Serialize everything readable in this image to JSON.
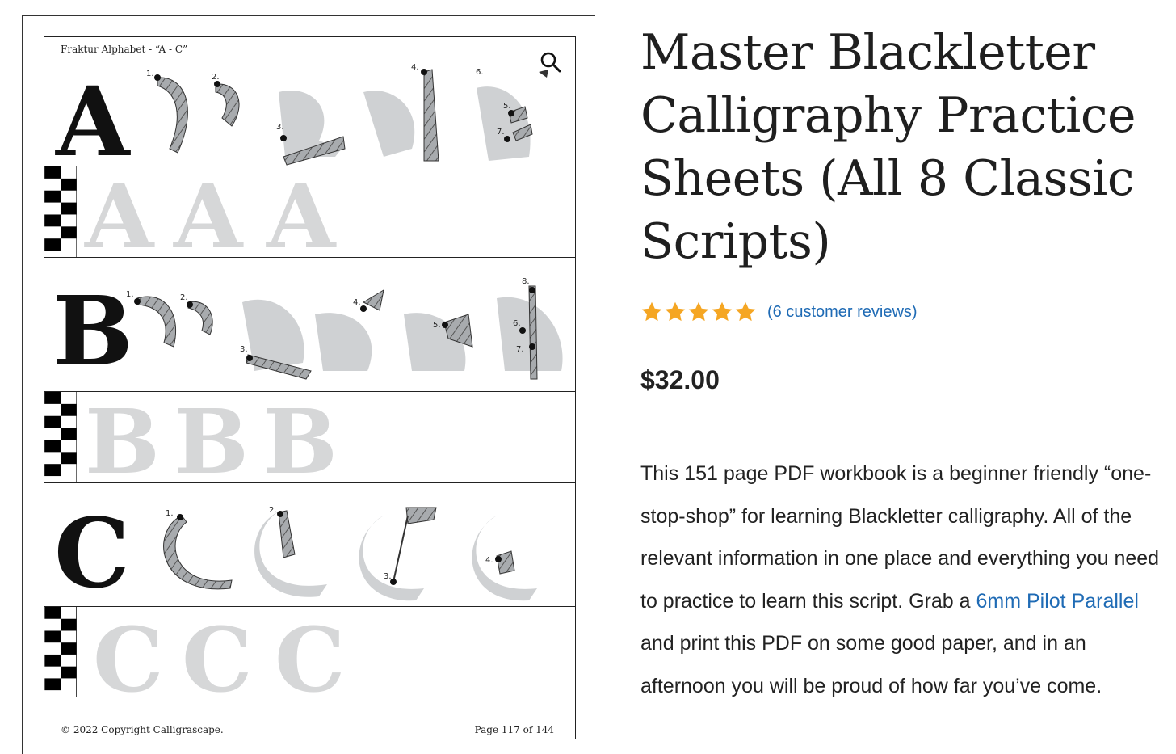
{
  "sheet": {
    "title": "Fraktur Alphabet - “A - C”",
    "zoom_icon": "magnifier-icon",
    "copyright": "© 2022 Copyright Calligrascape.",
    "page_label": "Page 117 of 144",
    "letters": [
      "A",
      "B",
      "C"
    ],
    "stroke_numbers_a": [
      "1.",
      "2.",
      "3.",
      "4.",
      "5.",
      "6.",
      "7."
    ],
    "stroke_numbers_b": [
      "1.",
      "2.",
      "3.",
      "4.",
      "5.",
      "6.",
      "7.",
      "8."
    ],
    "stroke_numbers_c": [
      "1.",
      "2.",
      "3.",
      "4."
    ]
  },
  "product": {
    "title": "Master Blackletter Calligraphy Practice Sheets (All 8 Classic Scripts)",
    "rating": 5,
    "rating_icon": "star-icon",
    "star_color": "#f5a623",
    "reviews_link": "(6 customer reviews)",
    "price": "$32.00",
    "description_before": "This 151 page PDF workbook is a beginner friendly “one-stop-shop” for learning Blackletter calligraphy. All of the relevant information in one place and everything you need to practice to learn this script. Grab a ",
    "description_link": "6mm Pilot Parallel",
    "description_after": " and print this PDF on some good paper, and in an afternoon you will be proud of how far you’ve come.",
    "link_color": "#1f6bb5"
  }
}
